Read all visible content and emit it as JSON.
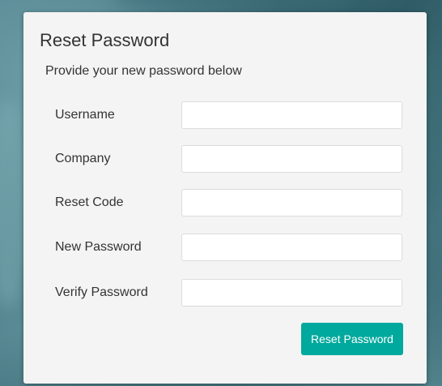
{
  "panel": {
    "title": "Reset Password",
    "subtitle": "Provide your new password below"
  },
  "form": {
    "fields": [
      {
        "label": "Username",
        "value": "",
        "placeholder": ""
      },
      {
        "label": "Company",
        "value": "",
        "placeholder": ""
      },
      {
        "label": "Reset Code",
        "value": "",
        "placeholder": ""
      },
      {
        "label": "New Password",
        "value": "",
        "placeholder": ""
      },
      {
        "label": "Verify Password",
        "value": "",
        "placeholder": ""
      }
    ],
    "submit_label": "Reset Password"
  },
  "colors": {
    "accent": "#00a99d",
    "panel_background": "#f4f4f4",
    "text": "#333333"
  }
}
